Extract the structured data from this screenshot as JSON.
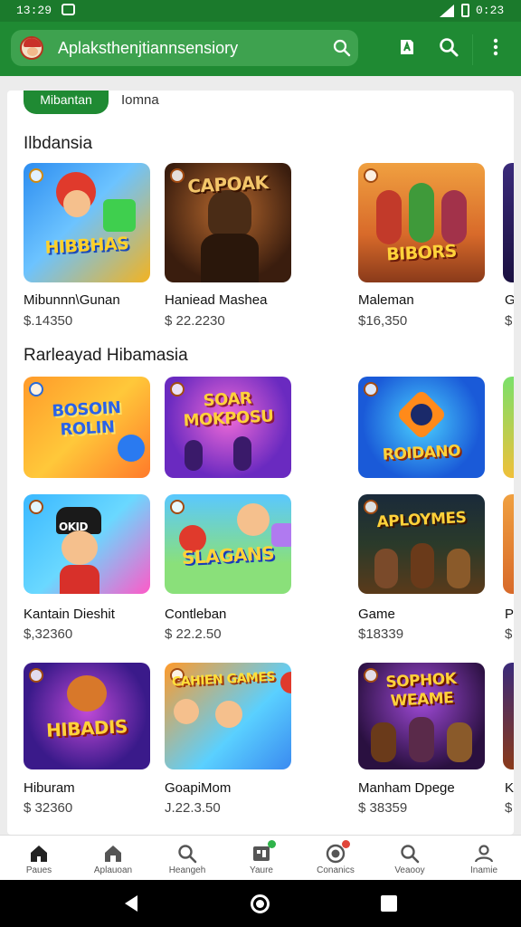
{
  "status_bar": {
    "time_left": "13:29",
    "time_right": "0:23"
  },
  "app_bar": {
    "search_text": "Aplaksthenjtiannsensiory"
  },
  "tabs": [
    {
      "label": "Mibantan",
      "active": true
    },
    {
      "label": "Iomna",
      "active": false
    }
  ],
  "sections": [
    {
      "title": "Ilbdansia"
    },
    {
      "title": "Rarleayad Hibamasia"
    }
  ],
  "row1": [
    {
      "title": "Mibunnn\\Gunan",
      "price": "$.14350",
      "art_text": "HIBBHAS"
    },
    {
      "title": "Haniead Mashea",
      "price": "$ 22.2230",
      "art_text": "CAPOAK"
    },
    {
      "title": "Maleman",
      "price": "$16,350",
      "art_text": "BIBORS"
    },
    {
      "title": "G",
      "price": "$"
    }
  ],
  "grid_rows": [
    [
      {
        "title": "",
        "price": "",
        "art_text": "BOSOIN ROLIN"
      },
      {
        "title": "",
        "price": "",
        "art_text": "SOAR MOKPOSU"
      },
      {
        "title": "",
        "price": "",
        "art_text": "ROIDANO"
      },
      {
        "title": "",
        "price": ""
      }
    ],
    [
      {
        "title": "Kantain Dieshit",
        "price": "$,32360",
        "art_text": "OKID"
      },
      {
        "title": "Contleban",
        "price": "$ 22.2.50",
        "art_text": "SLAGANS"
      },
      {
        "title": "Game",
        "price": "$18339",
        "art_text": "APLOYMES"
      },
      {
        "title": "P",
        "price": "$"
      }
    ],
    [
      {
        "title": "Hiburam",
        "price": "$ 32360",
        "art_text": "HIBADIS"
      },
      {
        "title": "GoapiMom",
        "price": "J.22.3.50",
        "art_text": "CAHIEN GAMES"
      },
      {
        "title": "Manham Dpege",
        "price": "$ 38359",
        "art_text": "SOPHOK WEAME"
      },
      {
        "title": "K",
        "price": "$"
      }
    ]
  ],
  "bottom_nav": [
    {
      "label": "Paues",
      "icon": "home-icon"
    },
    {
      "label": "Aplauoan",
      "icon": "house-icon"
    },
    {
      "label": "Heangeh",
      "icon": "search-icon"
    },
    {
      "label": "Yaure",
      "icon": "library-icon"
    },
    {
      "label": "Conanics",
      "icon": "record-icon"
    },
    {
      "label": "Veaooy",
      "icon": "search-icon"
    },
    {
      "label": "Inamie",
      "icon": "profile-icon"
    }
  ],
  "colors": {
    "brand_green": "#1f8a33",
    "status_green": "#1b7a2c",
    "nav_badge_green": "#2fb34a",
    "nav_badge_red": "#e0453a"
  }
}
